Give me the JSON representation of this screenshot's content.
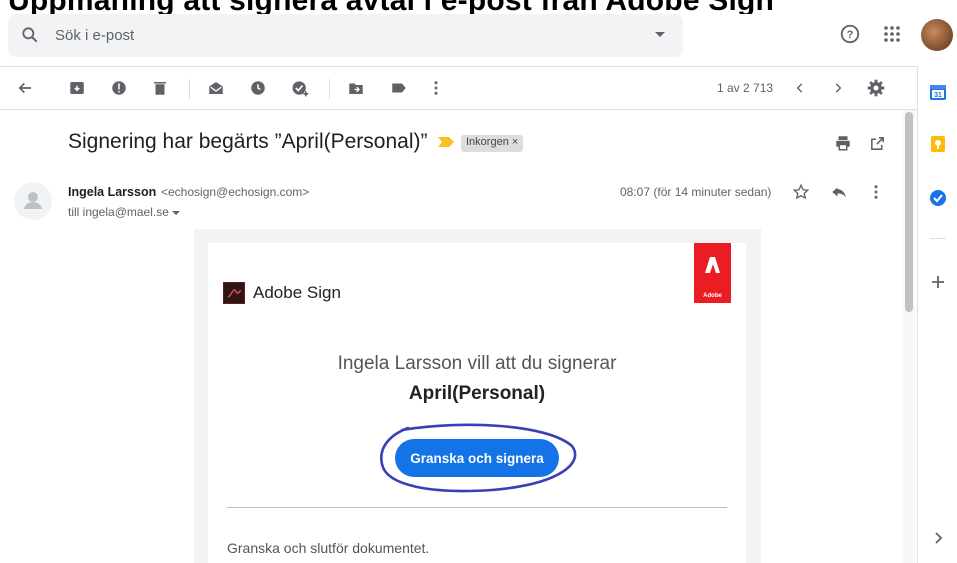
{
  "caption": "Uppmaning att signera avtal i e-post fran Adobe Sign",
  "search": {
    "placeholder": "Sök i e-post"
  },
  "toolbar": {
    "pager": "1 av 2 713"
  },
  "email": {
    "subject": "Signering har begärts ”April(Personal)”",
    "label": "Inkorgen ×",
    "sender_name": "Ingela Larsson",
    "sender_email": "<echosign@echosign.com>",
    "to": "till ingela@mael.se",
    "time": "08:07 (för 14 minuter sedan)"
  },
  "body": {
    "brand": "Adobe Sign",
    "adobe_tag": "Adobe",
    "invite": "Ingela Larsson vill att du signerar",
    "document": "April(Personal)",
    "cta": "Granska och signera",
    "footer": "Granska och slutför dokumentet."
  },
  "colors": {
    "accent": "#1473e6",
    "adobe_red": "#ec1c24",
    "annotation": "#3a3fb8"
  },
  "icons": [
    "search-icon",
    "help-icon",
    "apps-icon",
    "back-icon",
    "archive-icon",
    "spam-icon",
    "delete-icon",
    "mark-unread-icon",
    "snooze-icon",
    "add-task-icon",
    "move-icon",
    "label-icon",
    "more-icon",
    "prev-icon",
    "next-icon",
    "settings-icon",
    "print-icon",
    "open-new-window-icon",
    "star-icon",
    "reply-icon",
    "calendar-icon",
    "keep-icon",
    "tasks-icon",
    "plus-icon",
    "expand-icon"
  ]
}
